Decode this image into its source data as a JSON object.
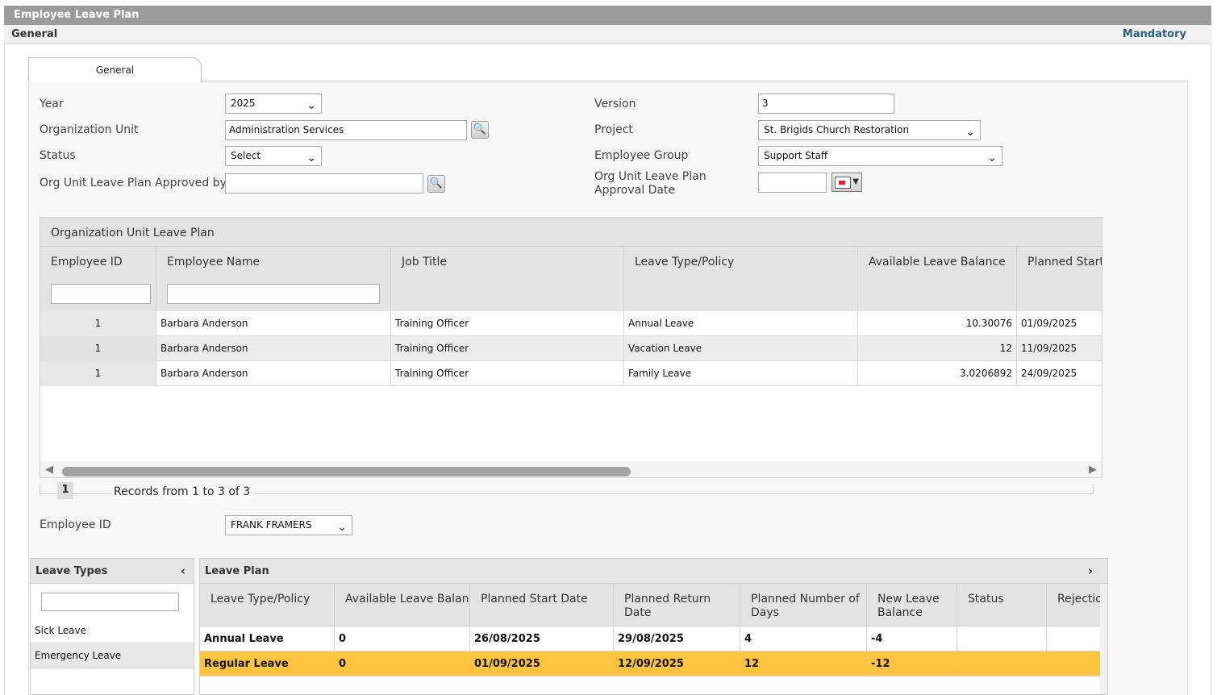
{
  "window": {
    "title": "Employee Leave Plan",
    "section": "General",
    "mandatory_link": "Mandatory"
  },
  "tabs": [
    {
      "label": "General",
      "selected": true
    }
  ],
  "form": {
    "year": {
      "label": "Year",
      "value": "2025"
    },
    "org_unit": {
      "label": "Organization Unit",
      "value": "Administration Services"
    },
    "status": {
      "label": "Status",
      "value": "Select"
    },
    "approved_by": {
      "label": "Org Unit Leave Plan Approved by",
      "value": ""
    },
    "version": {
      "label": "Version",
      "value": "3"
    },
    "project": {
      "label": "Project",
      "value": "St. Brigids Church Restoration"
    },
    "employee_group": {
      "label": "Employee Group",
      "value": "Support Staff"
    },
    "approval_date": {
      "label": "Org Unit Leave Plan Approval Date",
      "value": ""
    }
  },
  "org_plan": {
    "caption": "Organization Unit Leave Plan",
    "columns": [
      "Employee ID",
      "Employee Name",
      "Job Title",
      "Leave Type/Policy",
      "Available Leave Balance",
      "Planned Start D"
    ],
    "rows": [
      [
        "1",
        "Barbara Anderson",
        "Training Officer",
        "Annual Leave",
        "10.30076",
        "01/09/2025"
      ],
      [
        "1",
        "Barbara Anderson",
        "Training Officer",
        "Vacation Leave",
        "12",
        "11/09/2025"
      ],
      [
        "1",
        "Barbara Anderson",
        "Training Officer",
        "Family Leave",
        "3.0206892",
        "24/09/2025"
      ]
    ],
    "pager": {
      "page": "1",
      "records_text": "Records from 1 to 3 of 3"
    }
  },
  "employee": {
    "label": "Employee ID",
    "value": "FRANK FRAMERS"
  },
  "leave_types": {
    "title": "Leave Types",
    "items": [
      "Sick Leave",
      "Emergency Leave"
    ]
  },
  "leave_plan": {
    "title": "Leave Plan",
    "columns": [
      "Leave Type/Policy",
      "Available Leave Balance",
      "Planned Start Date",
      "Planned Return Date",
      "Planned Number of Days",
      "New Leave Balance",
      "Status",
      "Rejection"
    ],
    "rows": [
      [
        "Annual Leave",
        "0",
        "26/08/2025",
        "29/08/2025",
        "4",
        "-4",
        "",
        ""
      ],
      [
        "Regular Leave",
        "0",
        "01/09/2025",
        "12/09/2025",
        "12",
        "-12",
        "",
        ""
      ]
    ]
  },
  "colors": {
    "title_bar": "#9b9b9b",
    "link": "#2c5d82",
    "highlight_row": "#fec440"
  },
  "icons": [
    "search-icon",
    "calendar-icon",
    "chevron-down-icon",
    "chevron-left-icon",
    "chevron-right-icon"
  ]
}
